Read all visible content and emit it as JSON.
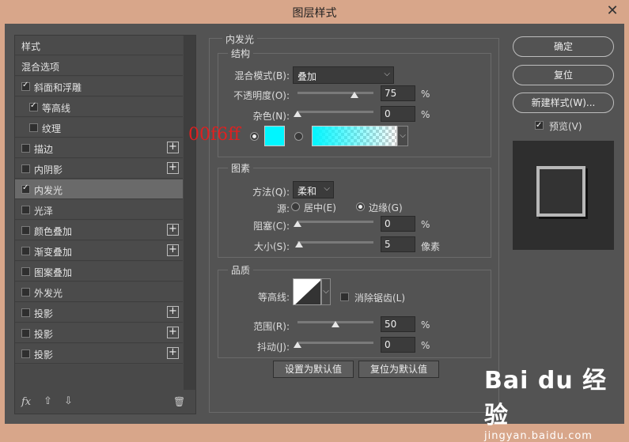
{
  "window": {
    "title": "图层样式",
    "close": "✕"
  },
  "left": {
    "rows": [
      {
        "label": "样式",
        "has_checkbox": false,
        "checked": false,
        "plus": false,
        "active": false,
        "indent": 0
      },
      {
        "label": "混合选项",
        "has_checkbox": false,
        "checked": false,
        "plus": false,
        "active": false,
        "indent": 0
      },
      {
        "label": "斜面和浮雕",
        "has_checkbox": true,
        "checked": true,
        "plus": false,
        "active": false,
        "indent": 0
      },
      {
        "label": "等高线",
        "has_checkbox": true,
        "checked": true,
        "plus": false,
        "active": false,
        "indent": 1
      },
      {
        "label": "纹理",
        "has_checkbox": true,
        "checked": false,
        "plus": false,
        "active": false,
        "indent": 1
      },
      {
        "label": "描边",
        "has_checkbox": true,
        "checked": false,
        "plus": true,
        "active": false,
        "indent": 0
      },
      {
        "label": "内阴影",
        "has_checkbox": true,
        "checked": false,
        "plus": true,
        "active": false,
        "indent": 0
      },
      {
        "label": "内发光",
        "has_checkbox": true,
        "checked": true,
        "plus": false,
        "active": true,
        "indent": 0
      },
      {
        "label": "光泽",
        "has_checkbox": true,
        "checked": false,
        "plus": false,
        "active": false,
        "indent": 0
      },
      {
        "label": "颜色叠加",
        "has_checkbox": true,
        "checked": false,
        "plus": true,
        "active": false,
        "indent": 0
      },
      {
        "label": "渐变叠加",
        "has_checkbox": true,
        "checked": false,
        "plus": true,
        "active": false,
        "indent": 0
      },
      {
        "label": "图案叠加",
        "has_checkbox": true,
        "checked": false,
        "plus": false,
        "active": false,
        "indent": 0
      },
      {
        "label": "外发光",
        "has_checkbox": true,
        "checked": false,
        "plus": false,
        "active": false,
        "indent": 0
      },
      {
        "label": "投影",
        "has_checkbox": true,
        "checked": false,
        "plus": true,
        "active": false,
        "indent": 0
      },
      {
        "label": "投影",
        "has_checkbox": true,
        "checked": false,
        "plus": true,
        "active": false,
        "indent": 0
      },
      {
        "label": "投影",
        "has_checkbox": true,
        "checked": false,
        "plus": true,
        "active": false,
        "indent": 0
      }
    ],
    "bottom": {
      "fx": "fx",
      "up": "⇧",
      "down": "⇩",
      "trash": "🗑"
    }
  },
  "inner_glow": {
    "title": "内发光",
    "structure": {
      "title": "结构",
      "blend_label": "混合模式(B):",
      "blend_value": "叠加",
      "opacity_label": "不透明度(O):",
      "opacity_value": "75",
      "opacity_pct": 75,
      "noise_label": "杂色(N):",
      "noise_value": "0",
      "noise_pct": 0,
      "percent": "%",
      "color": "#00f6ff"
    },
    "elements": {
      "title": "图素",
      "method_label": "方法(Q):",
      "method_value": "柔和",
      "source_label": "源:",
      "center_label": "居中(E)",
      "edge_label": "边缘(G)",
      "choke_label": "阻塞(C):",
      "choke_value": "0",
      "choke_pct": 0,
      "size_label": "大小(S):",
      "size_value": "5",
      "size_pct": 2,
      "size_unit": "像素",
      "percent": "%"
    },
    "quality": {
      "title": "品质",
      "contour_label": "等高线:",
      "antialias_label": "消除锯齿(L)",
      "range_label": "范围(R):",
      "range_value": "50",
      "range_pct": 50,
      "jitter_label": "抖动(J):",
      "jitter_value": "0",
      "jitter_pct": 0,
      "percent": "%"
    },
    "set_default": "设置为默认值",
    "reset_default": "复位为默认值"
  },
  "right": {
    "ok": "确定",
    "reset": "复位",
    "new_style": "新建样式(W)...",
    "preview_label": "预览(V)",
    "preview_checked": true
  },
  "annotation": "00f6ff",
  "watermark": {
    "logo": "Bai du 经验",
    "url": "jingyan.baidu.com"
  }
}
